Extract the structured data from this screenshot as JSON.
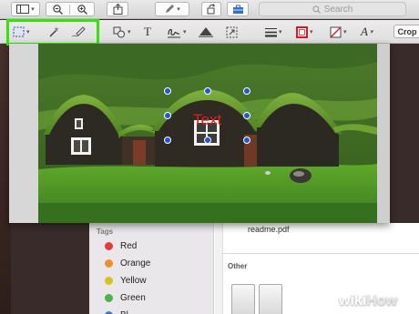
{
  "toolbar": {
    "search_placeholder": "Search"
  },
  "markup_toolbar": {
    "crop_label": "Crop",
    "highlight_color": "#32e600",
    "text_tool_glyph": "T",
    "font_tool_glyph": "A"
  },
  "image": {
    "text_annotation": "Text",
    "text_annotation_color": "#e0201a",
    "handle_color": "#2457d6"
  },
  "finder": {
    "tags_title": "Tags",
    "tags": [
      {
        "label": "Red",
        "color": "#e23b3b"
      },
      {
        "label": "Orange",
        "color": "#ef8f25"
      },
      {
        "label": "Yellow",
        "color": "#d9c21c"
      },
      {
        "label": "Green",
        "color": "#47b647"
      },
      {
        "label": "Bl",
        "color": "#3a79dd"
      }
    ],
    "file_name": "readme.pdf",
    "other_title": "Other"
  },
  "watermark": {
    "wiki": "wiki",
    "how": "How"
  }
}
